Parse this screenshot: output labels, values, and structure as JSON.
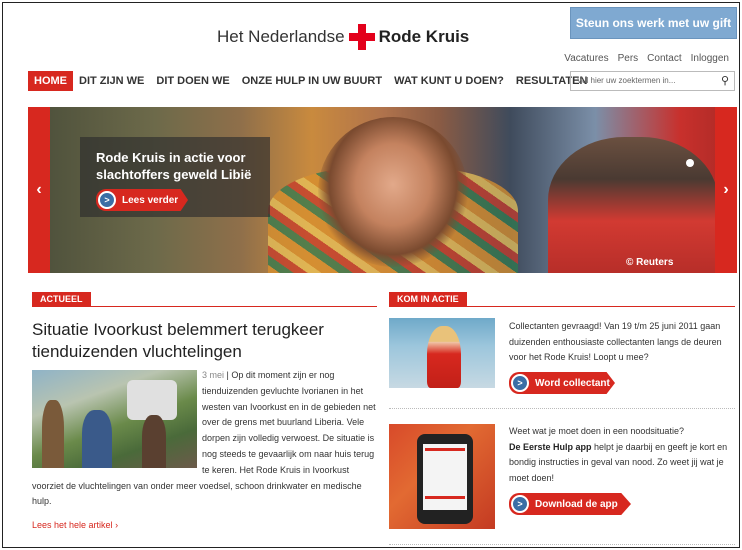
{
  "header": {
    "logo_part1": "Het Nederlandse",
    "logo_part2": "Rode Kruis",
    "gift_button": "Steun ons werk met uw gift",
    "utility_links": [
      "Vacatures",
      "Pers",
      "Contact",
      "Inloggen"
    ],
    "search_placeholder": "Vul hier uw zoektermen in..."
  },
  "nav": {
    "items": [
      "HOME",
      "DIT ZIJN WE",
      "DIT DOEN WE",
      "ONZE HULP IN UW BUURT",
      "WAT KUNT U DOEN?",
      "RESULTATEN"
    ],
    "active": "HOME"
  },
  "hero": {
    "headline": "Rode Kruis in actie voor slachtoffers geweld Libië",
    "button": "Lees verder",
    "credit": "© Reuters",
    "prev_icon": "‹",
    "next_icon": "›"
  },
  "actueel": {
    "tag": "ACTUEEL",
    "title": "Situatie Ivoorkust belemmert terugkeer tienduizenden vluchtelingen",
    "date": "3 mei",
    "body": "Op dit moment zijn er nog tienduizenden gevluchte Ivorianen in het westen van Ivoorkust en in de gebieden net over de grens met buurland Liberia. Vele dorpen zijn volledig verwoest. De situatie is nog steeds te gevaarlijk om naar huis terug te keren. Het Rode Kruis in Ivoorkust voorziet de vluchtelingen van onder meer voedsel, schoon drinkwater en medische hulp.",
    "read_more": "Lees het hele artikel"
  },
  "kom_in_actie": {
    "tag": "KOM IN ACTIE",
    "item1_text": "Collectanten gevraagd! Van 19 t/m 25 juni 2011 gaan duizenden enthousiaste collectanten langs de deuren voor het Rode Kruis! Loopt u mee?",
    "item1_button": "Word collectant",
    "item2_intro": "Weet wat je moet doen in een noodsituatie?",
    "item2_bold": "De Eerste Hulp app",
    "item2_text": "helpt je daarbij en geeft je kort en bondig instructies in geval van nood. Zo weet jij wat je moet doen!",
    "item2_button": "Download de app"
  },
  "colors": {
    "accent": "#d7281f",
    "gift": "#7fa9d1",
    "button_circle": "#3b6ea5"
  },
  "icons": [
    "search-icon",
    "chevron-left-icon",
    "chevron-right-icon",
    "arrow-right-icon"
  ]
}
